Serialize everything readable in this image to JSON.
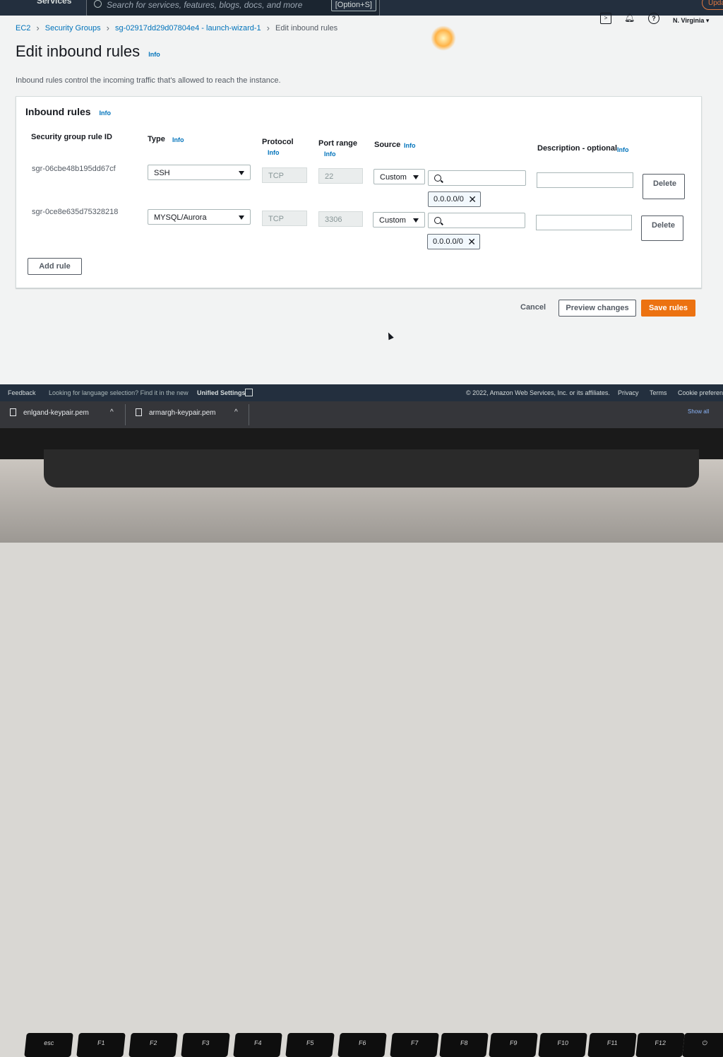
{
  "topbar": {
    "services_label": "Services",
    "search_placeholder": "Search for services, features, blogs, docs, and more",
    "search_shortcut": "[Option+S]",
    "update_label": "Upda",
    "region": "N. Virginia ▾"
  },
  "breadcrumb": [
    "EC2",
    "Security Groups",
    "sg-02917dd29d07804e4 - launch-wizard-1",
    "Edit inbound rules"
  ],
  "page": {
    "title": "Edit inbound rules",
    "info": "Info",
    "subtitle": "Inbound rules control the incoming traffic that's allowed to reach the instance."
  },
  "panel": {
    "title": "Inbound rules",
    "info": "Info",
    "columns": {
      "rule_id": "Security group rule ID",
      "type": "Type",
      "protocol": "Protocol",
      "port_range": "Port range",
      "source": "Source",
      "description": "Description - optional",
      "info": "Info"
    },
    "rules": [
      {
        "id": "sgr-06cbe48b195dd67cf",
        "type": "SSH",
        "protocol": "TCP",
        "port": "22",
        "source_type": "Custom",
        "cidr": "0.0.0.0/0",
        "delete_label": "Delete"
      },
      {
        "id": "sgr-0ce8e635d75328218",
        "type": "MYSQL/Aurora",
        "protocol": "TCP",
        "port": "3306",
        "source_type": "Custom",
        "cidr": "0.0.0.0/0",
        "delete_label": "Delete"
      }
    ],
    "add_rule_label": "Add rule"
  },
  "actions": {
    "cancel": "Cancel",
    "preview": "Preview changes",
    "save": "Save rules"
  },
  "footer": {
    "feedback": "Feedback",
    "language_prompt": "Looking for language selection? Find it in the new",
    "unified_settings": "Unified Settings",
    "copyright": "© 2022, Amazon Web Services, Inc. or its affiliates.",
    "privacy": "Privacy",
    "terms": "Terms",
    "cookie": "Cookie preference"
  },
  "downloads": {
    "files": [
      "enlgand-keypair.pem",
      "armargh-keypair.pem"
    ],
    "show_all": "Show all"
  },
  "keyboard": [
    "esc",
    "F1",
    "F2",
    "F3",
    "F4",
    "F5",
    "F6",
    "F7",
    "F8",
    "F9",
    "F10",
    "F11",
    "F12"
  ]
}
